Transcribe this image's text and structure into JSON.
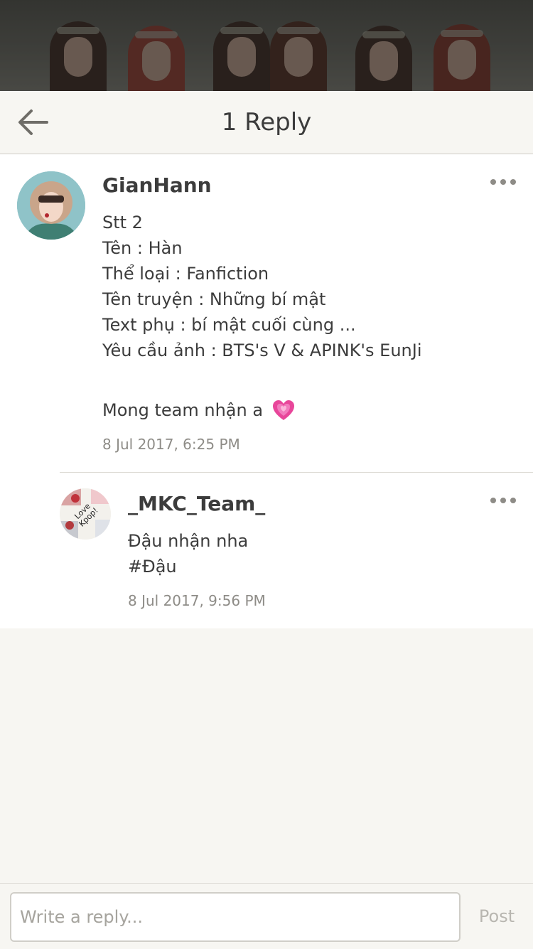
{
  "header": {
    "title": "1 Reply"
  },
  "post": {
    "author": "GianHann",
    "lines": [
      "Stt 2",
      "Tên : Hàn",
      "Thể loại : Fanfiction",
      "Tên truyện : Những bí mật",
      "Text phụ : bí mật cuối cùng ...",
      "Yêu cầu ảnh : BTS's V & APINK's EunJi"
    ],
    "closing": "Mong team nhận a",
    "timestamp": "8 Jul 2017, 6:25 PM",
    "emoji_icon": "growing-heart-icon",
    "emoji_color": "#e8469a"
  },
  "reply": {
    "author": "_MKC_Team_",
    "lines": [
      "Đậu nhận nha",
      "#Đậu"
    ],
    "timestamp": "8 Jul 2017, 9:56 PM",
    "avatar_text": [
      "Love",
      "Kpop!"
    ]
  },
  "composer": {
    "placeholder": "Write a reply...",
    "post_label": "Post"
  },
  "colors": {
    "background": "#f7f6f2",
    "card": "#ffffff",
    "text": "#3c3c3c",
    "muted": "#8e8c87",
    "post_disabled": "#b8b6b0"
  }
}
